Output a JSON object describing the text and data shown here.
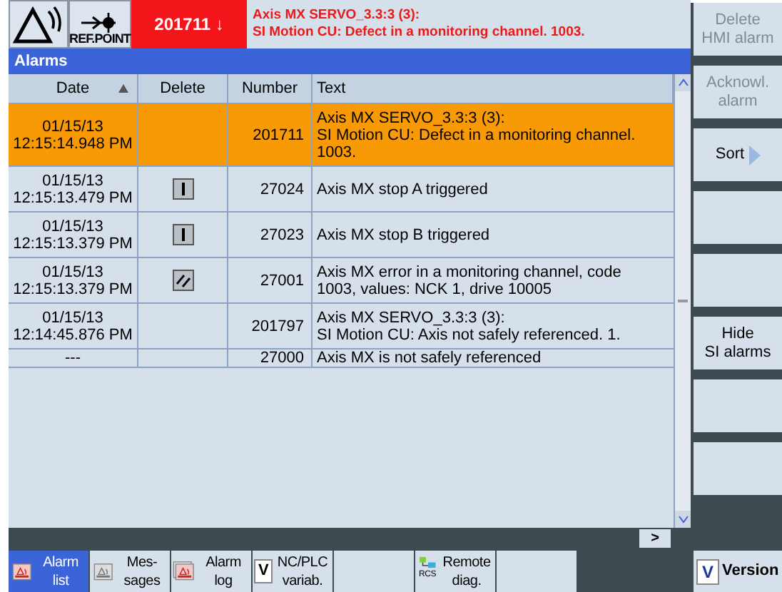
{
  "header": {
    "ref_point": "REF.POINT",
    "alarm_number": "201711",
    "alarm_arrow": "↓",
    "message_lines": [
      "Axis MX SERVO_3.3:3 (3):",
      "SI Motion CU: Defect in a monitoring channel. 1003."
    ]
  },
  "title": "Alarms",
  "table": {
    "columns": [
      {
        "label": "Date",
        "sorted_ascending": true
      },
      {
        "label": "Delete"
      },
      {
        "label": "Number"
      },
      {
        "label": "Text"
      }
    ],
    "rows": [
      {
        "date": "01/15/13",
        "time": "12:15:14.948 PM",
        "number": "201711",
        "text": [
          "Axis MX SERVO_3.3:3 (3):",
          "SI Motion CU: Defect in a monitoring channel.",
          "1003."
        ],
        "selected": true,
        "kind": "plain"
      },
      {
        "date": "01/15/13",
        "time": "12:15:13.479 PM",
        "kind": "bar",
        "number": "27024",
        "text": [
          "Axis MX stop A triggered"
        ],
        "selected": false
      },
      {
        "date": "01/15/13",
        "time": "12:15:13.379 PM",
        "kind": "bar",
        "number": "27023",
        "text": [
          "Axis MX stop B triggered"
        ],
        "selected": false
      },
      {
        "date": "01/15/13",
        "time": "12:15:13.379 PM",
        "kind": "slash",
        "number": "27001",
        "text": [
          "Axis MX error in a monitoring channel, code",
          "1003, values: NCK 1, drive 10005"
        ],
        "selected": false
      },
      {
        "date": "01/15/13",
        "time": "12:14:45.876 PM",
        "number": "201797",
        "text": [
          "Axis MX SERVO_3.3:3 (3):",
          "SI Motion CU: Axis not safely referenced. 1."
        ],
        "selected": false,
        "kind": "plain"
      },
      {
        "date": "---",
        "number": "27000",
        "text": [
          "Axis MX is not safely referenced"
        ],
        "selected": false,
        "kind": "plain"
      }
    ]
  },
  "scroll_right": ">",
  "vertical_softkeys": [
    {
      "kind": "label",
      "lines": [
        "Delete",
        "HMI alarm"
      ],
      "disabled": true
    },
    {
      "kind": "label",
      "lines": [
        "Acknowl.",
        "alarm"
      ],
      "disabled": true
    },
    {
      "kind": "label",
      "lines": [
        "Sort"
      ],
      "disabled": false,
      "arrow": true
    },
    {
      "kind": "blank"
    },
    {
      "kind": "blank"
    },
    {
      "kind": "label",
      "lines": [
        "Hide",
        "SI alarms"
      ],
      "disabled": false
    },
    {
      "kind": "blank"
    },
    {
      "kind": "blank"
    }
  ],
  "horizontal_softkeys": [
    {
      "kind": "alarm",
      "lines": [
        "Alarm",
        "list"
      ],
      "selected": true
    },
    {
      "kind": "messages",
      "lines": [
        "Mes-",
        "sages"
      ],
      "selected": false
    },
    {
      "kind": "log",
      "lines": [
        "Alarm",
        "log"
      ],
      "selected": false
    },
    {
      "kind": "variable",
      "icon_text": "V",
      "lines": [
        "NC/PLC",
        "variab."
      ],
      "selected": false
    },
    {
      "kind": "blank",
      "selected": false
    },
    {
      "kind": "remote",
      "icon_text": "RCS",
      "lines": [
        "Remote",
        "diag."
      ],
      "selected": false
    },
    {
      "kind": "blank",
      "selected": false
    }
  ],
  "version_key": {
    "label": "Version",
    "icon_text": "V"
  }
}
